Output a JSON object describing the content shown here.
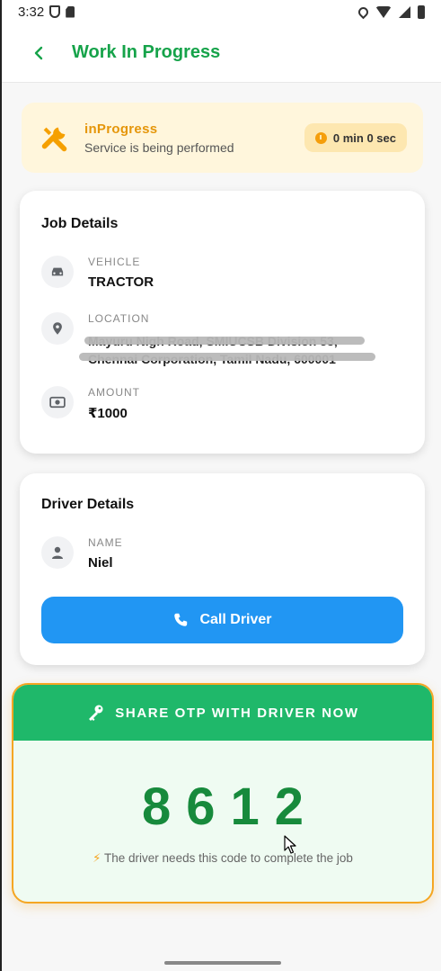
{
  "status_bar": {
    "time": "3:32"
  },
  "app_bar": {
    "title": "Work In Progress"
  },
  "status_banner": {
    "status": "inProgress",
    "subtitle": "Service is being performed",
    "timer": "0 min 0 sec"
  },
  "job_details": {
    "title": "Job Details",
    "vehicle_label": "VEHICLE",
    "vehicle_value": "TRACTOR",
    "location_label": "LOCATION",
    "location_line1": "Mayuru Nigh Road, SMIUCSB Division 53,",
    "location_line2": "Chennai Corporation, Tamil Nadu, 600001",
    "amount_label": "AMOUNT",
    "amount_value": "₹1000"
  },
  "driver_details": {
    "title": "Driver Details",
    "name_label": "NAME",
    "name_value": "Niel",
    "call_button": "Call Driver"
  },
  "otp": {
    "header": "SHARE OTP WITH DRIVER NOW",
    "code": "8612",
    "note": "The driver needs this code to complete the job"
  },
  "colors": {
    "primary_green": "#16a34a",
    "header_green": "#1fb86a",
    "otp_green": "#178a3c",
    "accent_orange": "#f5a623",
    "call_blue": "#2196f3"
  },
  "icons": [
    "back-icon",
    "tools-icon",
    "timer-icon",
    "vehicle-icon",
    "location-icon",
    "amount-icon",
    "person-icon",
    "phone-icon",
    "key-icon",
    "bolt-icon"
  ]
}
